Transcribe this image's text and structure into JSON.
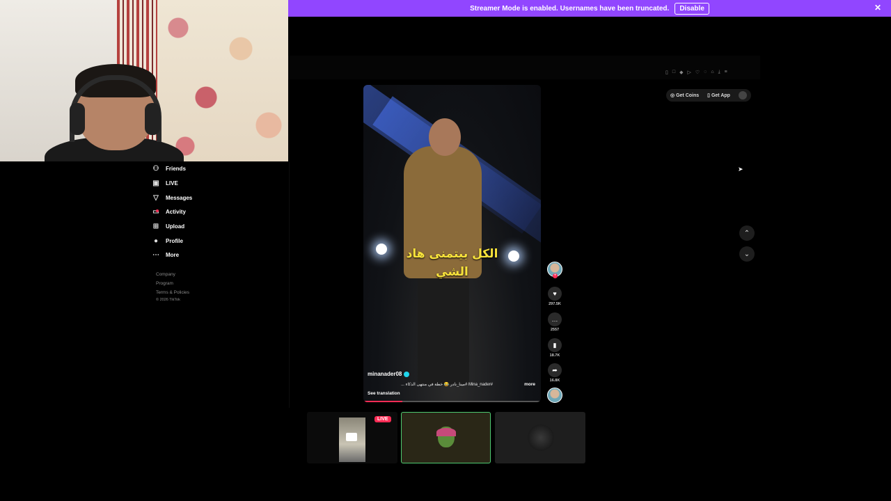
{
  "banner": {
    "message": "Streamer Mode is enabled. Usernames have been truncated.",
    "disable_label": "Disable",
    "close_glyph": "✕"
  },
  "header": {
    "get_coins": "Get Coins",
    "get_app": "Get App"
  },
  "sidebar": {
    "items": [
      {
        "label": "Friends",
        "icon": "friends-icon"
      },
      {
        "label": "LIVE",
        "icon": "live-icon"
      },
      {
        "label": "Messages",
        "icon": "messages-icon"
      },
      {
        "label": "Activity",
        "icon": "activity-icon"
      },
      {
        "label": "Upload",
        "icon": "upload-icon"
      },
      {
        "label": "Profile",
        "icon": "profile-icon"
      },
      {
        "label": "More",
        "icon": "more-icon"
      }
    ],
    "footer": [
      "Company",
      "Program",
      "Terms & Policies",
      "© 2026 TikTok"
    ]
  },
  "video": {
    "caption_line1": "الكل بيتمنى هاد",
    "caption_line2": "الشي",
    "username": "minanader08",
    "description": "#Mina_nader #مينا_نادر 😂 خطة في منتهى الذكاء ...",
    "more_label": "more",
    "see_translation": "See translation",
    "progress": 0.22
  },
  "actions": {
    "likes": "297.5K",
    "comments": "2557",
    "saves": "18.7K",
    "shares": "16.8K"
  },
  "thumbnails": {
    "live_badge": "LIVE"
  },
  "colors": {
    "banner": "#9146ff",
    "accent": "#fe2c55",
    "caption": "#f7e23b"
  }
}
